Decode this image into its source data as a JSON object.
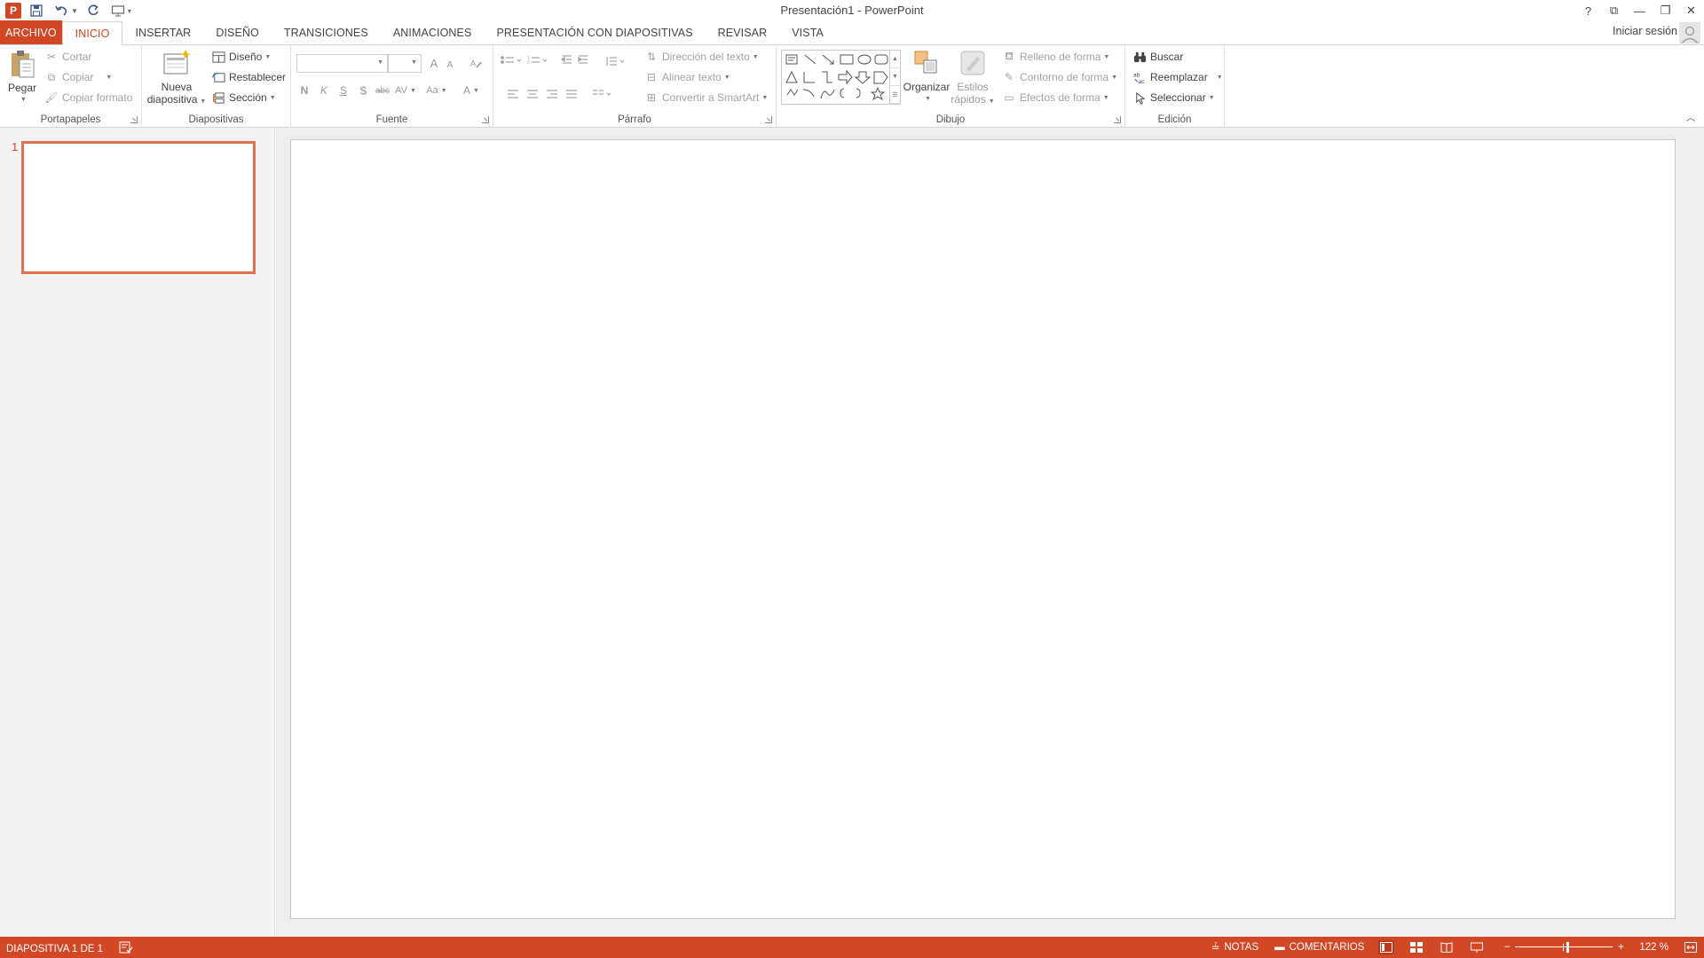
{
  "window": {
    "title": "Presentación1 - PowerPoint",
    "app_logo": "P",
    "controls": {
      "help": "?",
      "ribbon_options": "⧉",
      "minimize": "—",
      "restore": "❐",
      "close": "✕"
    }
  },
  "quick_access": {
    "items": [
      "save-icon",
      "undo-icon",
      "redo-icon",
      "start-from-beginning-icon",
      "customize-qat-icon"
    ]
  },
  "tabs": [
    {
      "label": "ARCHIVO"
    },
    {
      "label": "INICIO"
    },
    {
      "label": "INSERTAR"
    },
    {
      "label": "DISEÑO"
    },
    {
      "label": "TRANSICIONES"
    },
    {
      "label": "ANIMACIONES"
    },
    {
      "label": "PRESENTACIÓN CON DIAPOSITIVAS"
    },
    {
      "label": "REVISAR"
    },
    {
      "label": "VISTA"
    }
  ],
  "active_tab": "INICIO",
  "account": {
    "signin_label": "Iniciar sesión"
  },
  "ribbon": {
    "clipboard": {
      "label": "Portapapeles",
      "paste": "Pegar",
      "cut": "Cortar",
      "copy": "Copiar",
      "format_painter": "Copiar formato"
    },
    "slides": {
      "label": "Diapositivas",
      "new_slide_line1": "Nueva",
      "new_slide_line2": "diapositiva",
      "layout": "Diseño",
      "reset": "Restablecer",
      "section": "Sección"
    },
    "font": {
      "label": "Fuente",
      "name_value": "",
      "size_value": "",
      "grow": "A",
      "shrink": "A",
      "bold": "N",
      "italic": "K",
      "underline": "S",
      "shadow": "S",
      "strike": "abc",
      "spacing": "AV",
      "case": "Aa",
      "color": "A"
    },
    "paragraph": {
      "label": "Párrafo",
      "text_direction": "Dirección del texto",
      "align_text": "Alinear texto",
      "smartart": "Convertir a SmartArt"
    },
    "drawing": {
      "label": "Dibujo",
      "arrange": "Organizar",
      "quick_styles_line1": "Estilos",
      "quick_styles_line2": "rápidos",
      "shape_fill": "Relleno de forma",
      "shape_outline": "Contorno de forma",
      "shape_effects": "Efectos de forma"
    },
    "editing": {
      "label": "Edición",
      "find": "Buscar",
      "replace": "Reemplazar",
      "select": "Seleccionar"
    }
  },
  "thumbnails": [
    {
      "number": "1"
    }
  ],
  "status": {
    "slide_indicator": "DIAPOSITIVA 1 DE 1",
    "notes": "NOTAS",
    "comments": "COMENTARIOS",
    "zoom_label": "122 %",
    "zoom_level_percent": 122
  },
  "colors": {
    "accent": "#d24726",
    "thumb_border": "#e0714f"
  }
}
